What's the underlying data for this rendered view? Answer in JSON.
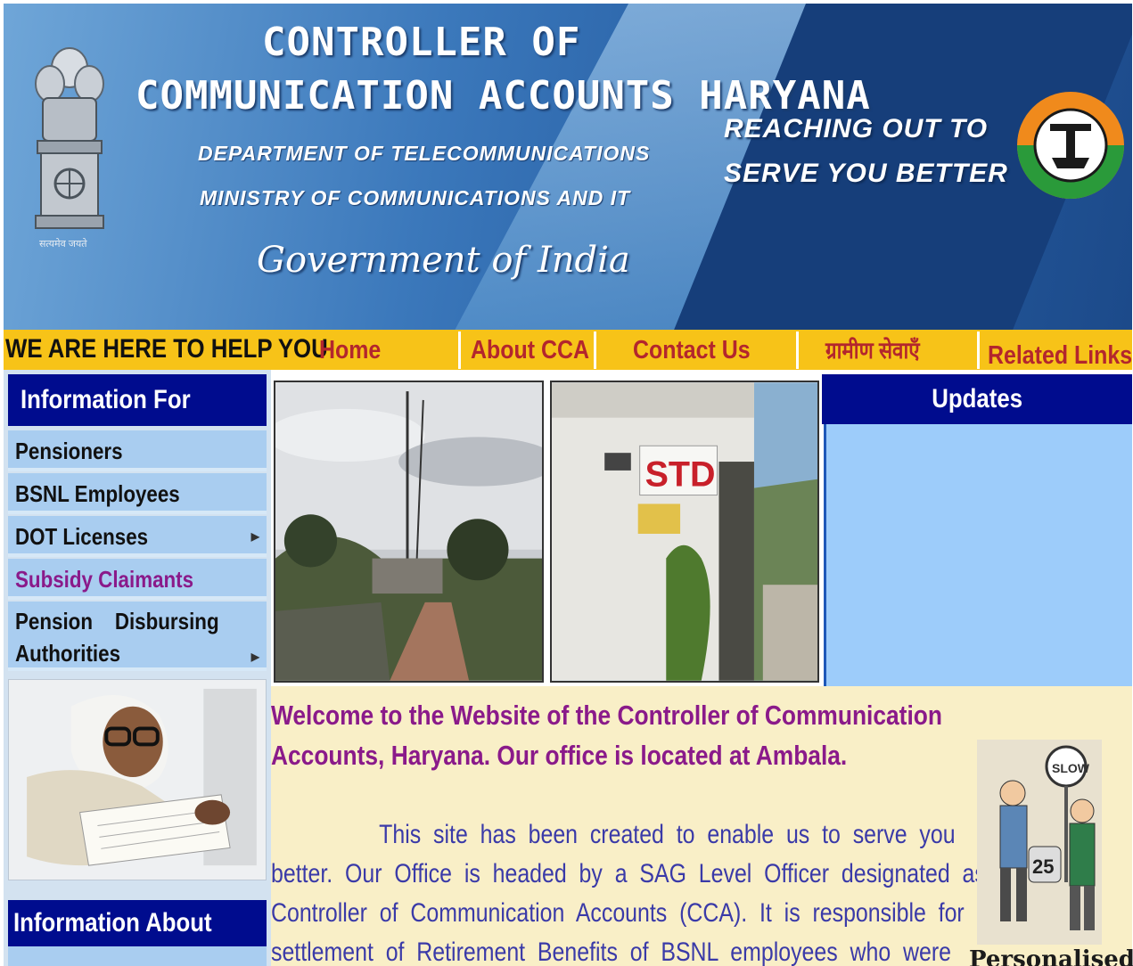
{
  "banner": {
    "title_line1": "CONTROLLER OF",
    "title_line2": "COMMUNICATION ACCOUNTS HARYANA",
    "dept": "DEPARTMENT OF TELECOMMUNICATIONS",
    "ministry": "MINISTRY OF COMMUNICATIONS AND IT",
    "govt": "Government of India",
    "slogan_line1": "REACHING OUT TO",
    "slogan_line2": "SERVE YOU BETTER",
    "emblem_caption": "सत्यमेव जयते"
  },
  "nav": {
    "tagline": "WE ARE HERE TO HELP YOU",
    "items": [
      "Home",
      "About CCA",
      "Contact Us",
      "ग्रामीण सेवाएँ",
      "Related Links"
    ]
  },
  "sidebar": {
    "heading": "Information For",
    "items": [
      {
        "label": "Pensioners"
      },
      {
        "label": "BSNL Employees"
      },
      {
        "label": "DOT Licenses"
      },
      {
        "label": "Subsidy Claimants"
      },
      {
        "label": "Pension    Disbursing"
      },
      {
        "label": "Authorities"
      }
    ],
    "heading2": "Information About"
  },
  "updates": {
    "heading": "Updates"
  },
  "content": {
    "welcome_line1": "Welcome to the Website of the Controller of Communication",
    "welcome_line2": "Accounts,  Haryana. Our office is located at Ambala.",
    "body_line1": "This  site  has  been  created  to  enable  us  to  serve  you",
    "body_line2": "better.  Our  Office  is  headed  by  a  SAG  Level  Officer  designated  as",
    "body_line3": "Controller  of  Communication  Accounts  (CCA).  It  is  responsible  for",
    "body_line4": "settlement  of  Retirement  Benefits  of  BSNL  employees  who  were",
    "right_caption": "Personalised",
    "photo2_sign": "STD"
  },
  "colors": {
    "nav_bar": "#f7c318",
    "nav_text": "#b3262d",
    "sidebar_head": "#000c8e",
    "sidebar_item": "#a9cdf0",
    "updates_body": "#9dccfa",
    "content_bg": "#f9efc7",
    "welcome_text": "#8a1a8a",
    "body_text": "#3a3aa8"
  }
}
